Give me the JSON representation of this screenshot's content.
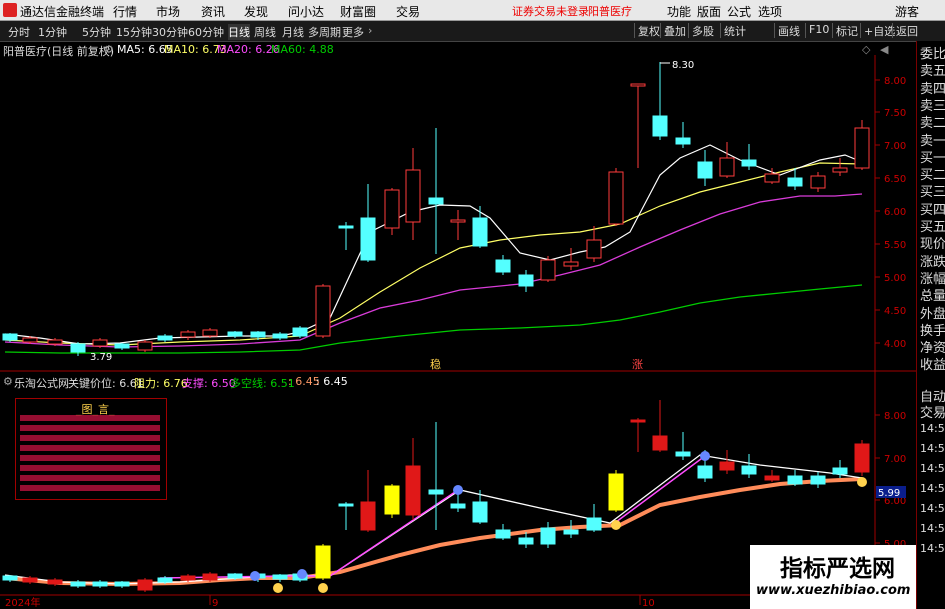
{
  "menubar": {
    "app_title": "通达信金融终端",
    "items": [
      "行情",
      "市场",
      "资讯",
      "发现",
      "问小达",
      "财富圈",
      "交易"
    ],
    "notice": "证券交易未登录",
    "stock_name": "阳普医疗",
    "right_items": [
      "功能",
      "版面",
      "公式",
      "选项",
      "游客"
    ]
  },
  "toolbar": {
    "periods": [
      "分时",
      "1分钟",
      "5分钟",
      "15分钟",
      "30分钟",
      "60分钟",
      "日线",
      "周线",
      "月线",
      "多周期",
      "更多"
    ],
    "active": "日线",
    "buttons": [
      "复权",
      "叠加",
      "多股",
      "统计",
      "画线",
      "F10",
      "标记",
      "+自选",
      "返回"
    ]
  },
  "main_header": {
    "title": "阳普医疗(日线 前复权)",
    "ma5": "MA5: 6.65",
    "ma10": "MA10: 6.73",
    "ma20": "MA20: 6.26",
    "ma60": "MA60: 4.88"
  },
  "sub_header": {
    "title": "乐淘公式网",
    "key_price": "关键价位: 6.61",
    "resistance": "阻力: 6.76",
    "support": "支撑: 6.50",
    "long_short": "多空线: 6.51",
    "v1": ": 6.45",
    "v2": ": 6.45"
  },
  "chart_data": {
    "type": "candlestick",
    "high_annotation": "8.30",
    "low_annotation": "3.79",
    "main_y_ticks": [
      "8.00",
      "7.50",
      "7.00",
      "6.50",
      "6.00",
      "5.50",
      "5.00",
      "4.50",
      "4.00"
    ],
    "sub_y_ticks": [
      "8.00",
      "7.00",
      "6.00",
      "5.00"
    ],
    "sub_current": "5.99",
    "markers": [
      "稳",
      "涨"
    ],
    "x_labels": [
      "2024年",
      "9",
      "10"
    ]
  },
  "legend_box": {
    "title": "_图_言_"
  },
  "right_panel": {
    "items": [
      "委比",
      "卖五",
      "卖四",
      "卖三",
      "卖二",
      "卖一",
      "买一",
      "买二",
      "买三",
      "买四",
      "买五",
      "现价",
      "涨跌",
      "涨幅",
      "总量",
      "外盘",
      "换手",
      "净资",
      "收益"
    ],
    "sub_items": [
      "自动",
      "交易"
    ],
    "sub_times": [
      "14:5",
      "14:5",
      "14:5",
      "14:5",
      "14:5",
      "14:5",
      "14:5"
    ]
  },
  "watermark": {
    "cn": "指标严选网",
    "url": "www.xuezhibiao.com"
  },
  "colors": {
    "up": "#ff3c3c",
    "down": "#54ffff",
    "ma5": "#ffffff",
    "ma10": "#ffff66",
    "ma20": "#ff4cff",
    "ma60": "#00cc00"
  }
}
